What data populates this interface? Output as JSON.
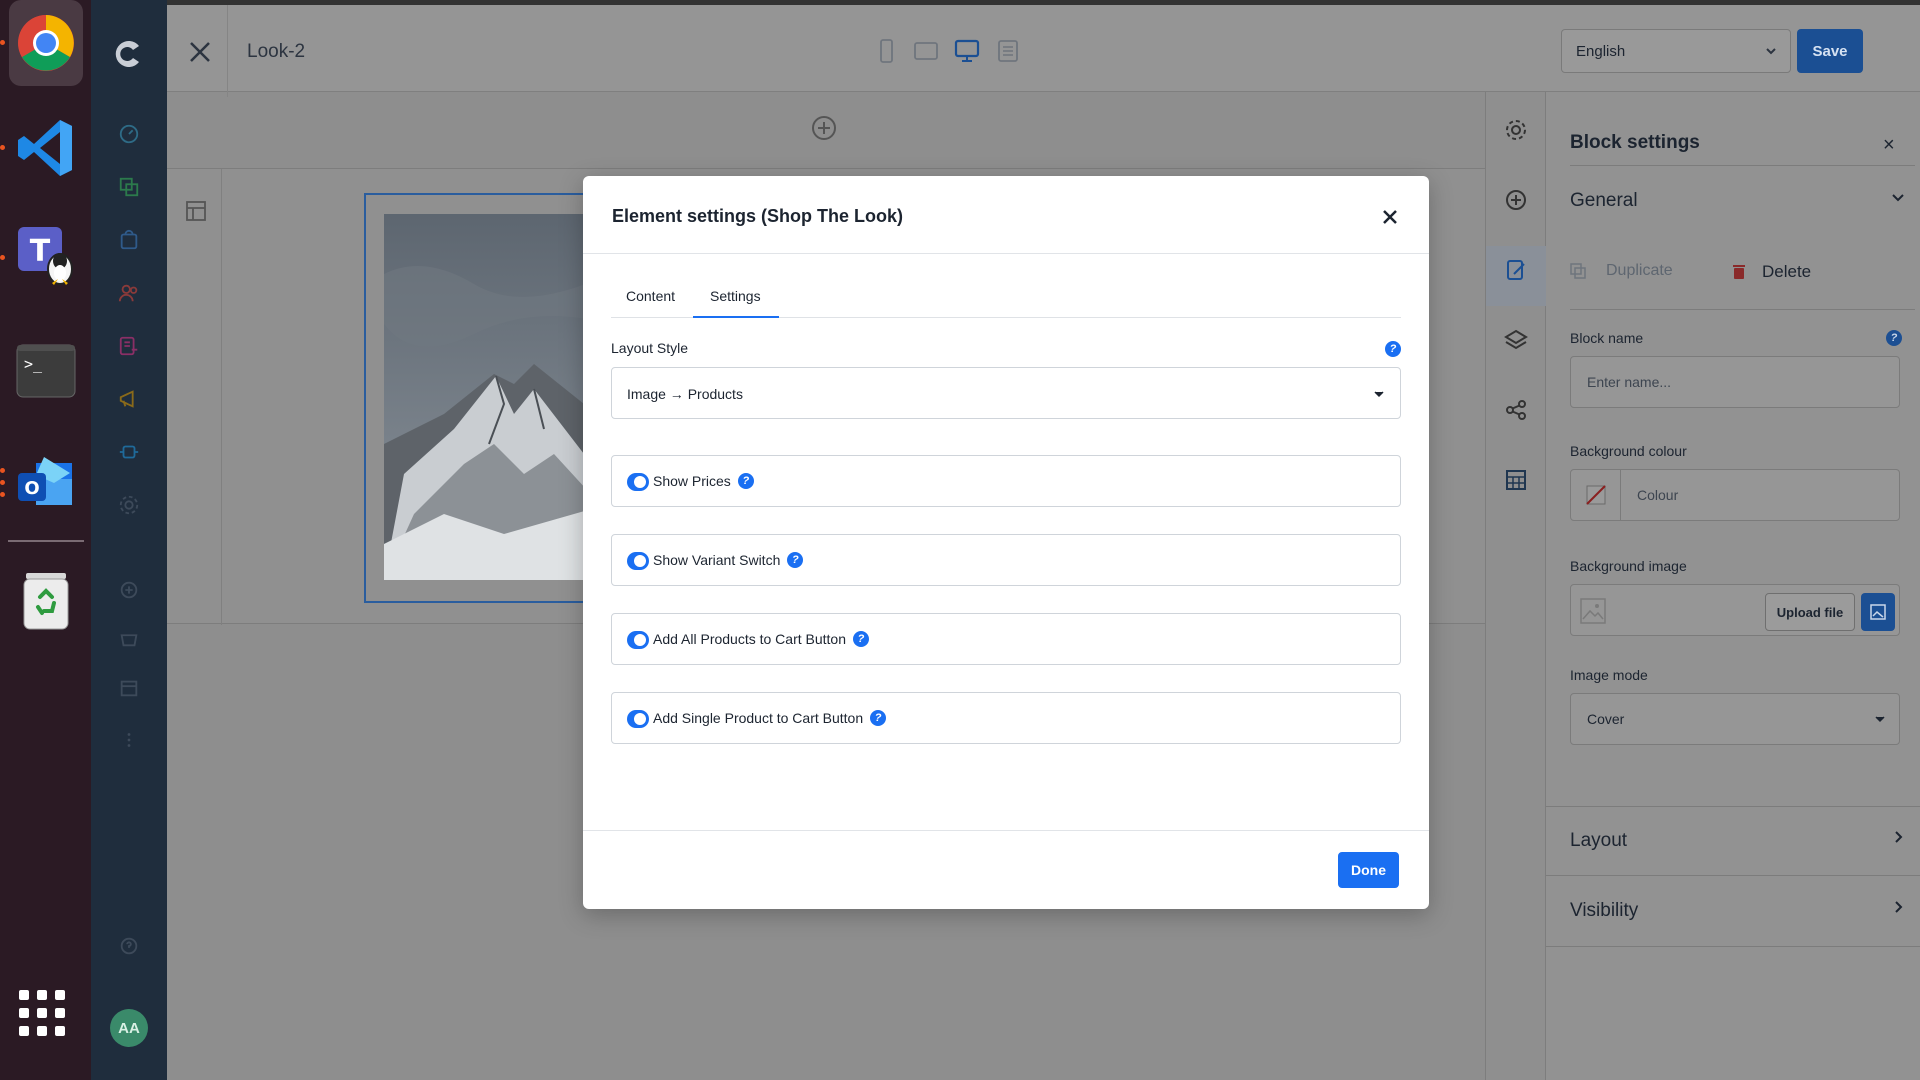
{
  "dock": {
    "apps": [
      "chrome-icon",
      "vscode-icon",
      "teams-icon",
      "terminal-icon",
      "outlook-icon",
      "trash-icon"
    ],
    "terminal_prompt": ">_"
  },
  "app_sidebar": {
    "avatar_initials": "AA"
  },
  "topbar": {
    "page_title": "Look-2",
    "language": "English",
    "save_label": "Save"
  },
  "block_settings": {
    "title": "Block settings",
    "close_glyph": "×",
    "general_label": "General",
    "duplicate_label": "Duplicate",
    "delete_label": "Delete",
    "block_name_label": "Block name",
    "block_name_placeholder": "Enter name...",
    "background_colour_label": "Background colour",
    "colour_placeholder": "Colour",
    "background_image_label": "Background image",
    "upload_label": "Upload file",
    "image_mode_label": "Image mode",
    "image_mode_value": "Cover",
    "layout_label": "Layout",
    "visibility_label": "Visibility",
    "info_glyph": "?"
  },
  "modal": {
    "title": "Element settings (Shop The Look)",
    "tabs": [
      {
        "label": "Content",
        "active": false
      },
      {
        "label": "Settings",
        "active": true
      }
    ],
    "layout_style_label": "Layout Style",
    "layout_style_value": "Image → Products",
    "info_glyph": "?",
    "options": [
      {
        "label": "Show Prices",
        "enabled": true
      },
      {
        "label": "Show Variant Switch",
        "enabled": true
      },
      {
        "label": "Add All Products to Cart Button",
        "enabled": true
      },
      {
        "label": "Add Single Product to Cart Button",
        "enabled": true
      }
    ],
    "done_label": "Done"
  },
  "colors": {
    "accent": "#1a6ff2",
    "dimmed_primary": "#1b4f93",
    "sidebar": "#1f2d3d",
    "dock": "#2b1a24"
  }
}
